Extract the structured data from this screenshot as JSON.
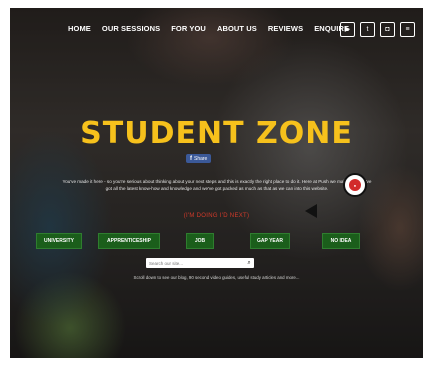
{
  "nav": {
    "items": [
      {
        "label": "HOME"
      },
      {
        "label": "OUR SESSIONS"
      },
      {
        "label": "FOR YOU"
      },
      {
        "label": "ABOUT US"
      },
      {
        "label": "REVIEWS"
      },
      {
        "label": "ENQUIRE"
      }
    ]
  },
  "social": [
    {
      "icon": "youtube-icon",
      "glyph": "▶"
    },
    {
      "icon": "twitter-icon",
      "glyph": "t"
    },
    {
      "icon": "instagram-icon",
      "glyph": "◘"
    },
    {
      "icon": "menu-icon",
      "glyph": "≡"
    }
  ],
  "hero": {
    "title": "STUDENT ZONE",
    "title_color": "#f6c11c",
    "share_label": "Share",
    "intro": "You've made it here - so you're serious about thinking about your next steps and this is exactly the right place to do it. Here at Push we make sure we've got all the latest know-how and knowledge and we've got packed as much as that as we can into this website.",
    "cta_text": "(I'M DOING I'D NEXT)",
    "cta_color": "#d23a2a"
  },
  "choices": [
    {
      "label": "UNIVERSITY"
    },
    {
      "label": "APPRENTICESHIP"
    },
    {
      "label": "JOB"
    },
    {
      "label": "GAP YEAR"
    },
    {
      "label": "NO IDEA"
    }
  ],
  "choice_color": "#1b5e1b",
  "search": {
    "placeholder": "Search our site...",
    "icon": "search-icon"
  },
  "scroll_note": "Scroll down to see our blog, 90 second video guides, useful study articles and more..."
}
